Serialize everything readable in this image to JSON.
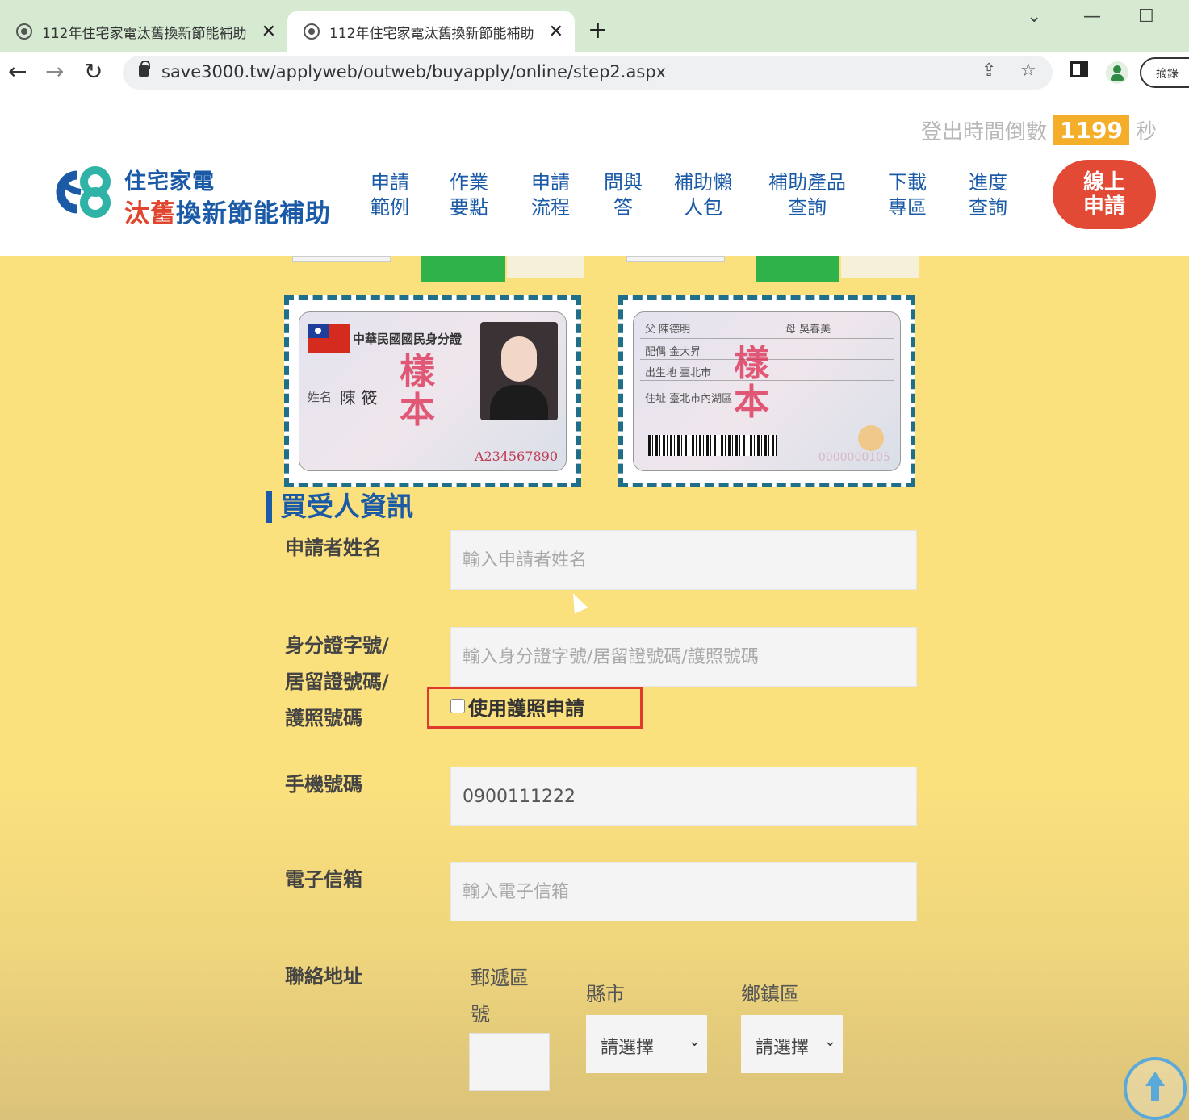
{
  "browser": {
    "tabs": [
      {
        "title": "112年住宅家電汰舊換新節能補助"
      },
      {
        "title": "112年住宅家電汰舊換新節能補助"
      }
    ],
    "new_tab": "+",
    "url": "save3000.tw/applyweb/outweb/buyapply/online/step2.aspx",
    "pill_button": "摘錄"
  },
  "header": {
    "countdown_label": "登出時間倒數",
    "countdown_value": "1199",
    "countdown_unit": "秒",
    "logo_line1": "住宅家電",
    "logo_line2_red": "汰舊",
    "logo_line2_blue": "換新節能補助",
    "nav": [
      {
        "line1": "申請",
        "line2": "範例"
      },
      {
        "line1": "作業",
        "line2": "要點"
      },
      {
        "line1": "申請",
        "line2": "流程"
      },
      {
        "line1": "問與",
        "line2": "答"
      },
      {
        "line1": "補助懶",
        "line2": "人包"
      },
      {
        "line1": "補助產品",
        "line2": "查詢"
      },
      {
        "line1": "下載",
        "line2": "專區"
      },
      {
        "line1": "進度",
        "line2": "查詢"
      }
    ],
    "apply_line1": "線上",
    "apply_line2": "申請"
  },
  "id_front": {
    "title": "中華民國國民身分證",
    "name_label": "姓名",
    "name_value": "陳 筱",
    "stamp_top": "樣",
    "stamp_bottom": "本",
    "id_number": "A234567890"
  },
  "id_back": {
    "father": "父 陳德明",
    "mother": "母 吳春美",
    "spouse": "配偶 金大昇",
    "birthplace": "出生地 臺北市",
    "address": "住址 臺北市內湖區",
    "stamp_top": "樣",
    "stamp_bottom": "本",
    "serial": "0000000105"
  },
  "form": {
    "section_title": "買受人資訊",
    "name_label": "申請者姓名",
    "name_placeholder": "輸入申請者姓名",
    "id_label_1": "身分證字號/",
    "id_label_2": "居留證號碼/",
    "id_label_3": "護照號碼",
    "id_placeholder": "輸入身分證字號/居留證號碼/護照號碼",
    "passport_checkbox_label": "使用護照申請",
    "phone_label": "手機號碼",
    "phone_value": "0900111222",
    "email_label": "電子信箱",
    "email_placeholder": "輸入電子信箱",
    "address_label": "聯絡地址",
    "zip_label_1": "郵遞區",
    "zip_label_2": "號",
    "city_label": "縣市",
    "city_select": "請選擇",
    "town_label": "鄉鎮區",
    "town_select": "請選擇"
  }
}
